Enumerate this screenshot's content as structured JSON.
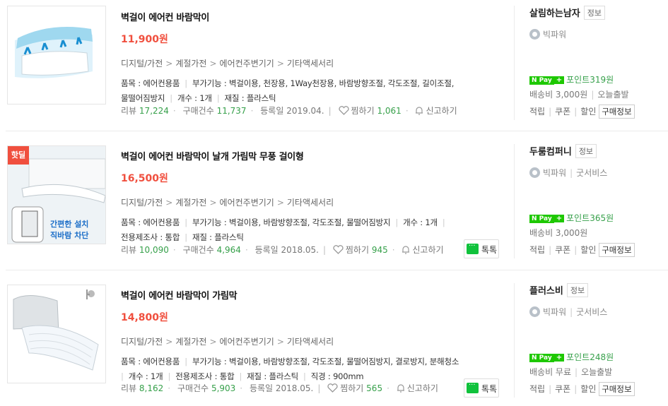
{
  "products": [
    {
      "title": "벽걸이 에어컨 바람막이",
      "price": "11,900원",
      "category": [
        "디지털/가전",
        "계절가전",
        "에어컨주변기기",
        "기타액세서리"
      ],
      "specs_line1": "품목 : 에어컨용품",
      "specs_line2": "부가기능 : 벽걸이용, 천장용, 1Way천장용, 바람방향조절, 각도조절, 길이조절,",
      "specs_line3": "물떨어짐방지",
      "specs_line4": "개수 : 1개",
      "specs_line5": "재질 : 플라스틱",
      "review_label": "리뷰",
      "review_count": "17,224",
      "purchase_label": "구매건수",
      "purchase_count": "11,737",
      "reg_label": "등록일",
      "reg_date": "2019.04.",
      "zzim_label": "찜하기",
      "zzim_count": "1,061",
      "report_label": "신고하기",
      "seller": "살림하는남자",
      "seller_tag": "정보",
      "grade": "빅파워",
      "service": "",
      "point_label": "포인트",
      "point": "319원",
      "shipping": "배송비 3,000원",
      "shipping_extra": "오늘출발",
      "actions": [
        "적립",
        "쿠폰",
        "할인"
      ],
      "info_btn": "구매정보"
    },
    {
      "title": "벽걸이 에어컨 바람막이 날개 가림막 무풍 걸이형",
      "price": "16,500원",
      "badge": "핫딜",
      "image_text_1": "간편한 설치",
      "image_text_2": "직바람 차단",
      "category": [
        "디지털/가전",
        "계절가전",
        "에어컨주변기기",
        "기타액세서리"
      ],
      "specs_line1": "품목 : 에어컨용품",
      "specs_line2": "부가기능 : 벽걸이용, 바람방향조절, 각도조절, 물떨어짐방지",
      "specs_line3": "개수 : 1개",
      "specs_line4": "전용제조사 : 통합",
      "specs_line5": "재질 : 플라스틱",
      "review_label": "리뷰",
      "review_count": "10,090",
      "purchase_label": "구매건수",
      "purchase_count": "4,964",
      "reg_label": "등록일",
      "reg_date": "2018.05.",
      "zzim_label": "찜하기",
      "zzim_count": "945",
      "report_label": "신고하기",
      "talk_label": "톡톡",
      "seller": "두룸컴퍼니",
      "seller_tag": "정보",
      "grade": "빅파워",
      "service": "굿서비스",
      "point_label": "포인트",
      "point": "365원",
      "shipping": "배송비 3,000원",
      "shipping_extra": "",
      "actions": [
        "적립",
        "쿠폰",
        "할인"
      ],
      "info_btn": "구매정보"
    },
    {
      "title": "벽걸이 에어컨 바람막이 가림막",
      "price": "14,800원",
      "category": [
        "디지털/가전",
        "계절가전",
        "에어컨주변기기",
        "기타액세서리"
      ],
      "specs_line1": "품목 : 에어컨용품",
      "specs_line2": "부가기능 : 벽걸이용, 바람방향조절, 각도조절, 물떨어짐방지, 결로방지, 분해청소",
      "specs_line3": "개수 : 1개",
      "specs_line4": "전용제조사 : 통합",
      "specs_line5": "재질 : 플라스틱",
      "specs_line6": "직경 : 900mm",
      "review_label": "리뷰",
      "review_count": "8,162",
      "purchase_label": "구매건수",
      "purchase_count": "5,903",
      "reg_label": "등록일",
      "reg_date": "2018.05.",
      "zzim_label": "찜하기",
      "zzim_count": "565",
      "report_label": "신고하기",
      "talk_label": "톡톡",
      "seller": "플러스비",
      "seller_tag": "정보",
      "grade": "빅파워",
      "service": "굿서비스",
      "point_label": "포인트",
      "point": "248원",
      "shipping": "배송비 무료",
      "shipping_extra": "오늘출발",
      "actions": [
        "적립",
        "쿠폰",
        "할인"
      ],
      "info_btn": "구매정보"
    }
  ],
  "npay_label": "N Pay",
  "icons": [
    "heart-icon",
    "bell-icon",
    "talk-icon",
    "medal-icon",
    "npay-icon"
  ],
  "colors": {
    "price": "#f04f3e",
    "count": "#36a04a",
    "npay": "#1ec800",
    "hot_badge": "#f04f3e"
  }
}
